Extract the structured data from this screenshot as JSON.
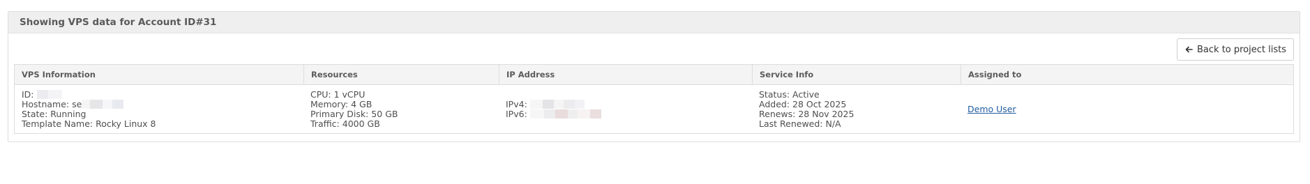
{
  "panel": {
    "title": "Showing VPS data for Account ID#31"
  },
  "toolbar": {
    "back_label": "Back to project lists",
    "back_icon": "arrow-left-icon"
  },
  "table": {
    "headers": [
      "VPS Information",
      "Resources",
      "IP Address",
      "Service Info",
      "Assigned to"
    ],
    "vps_info": {
      "id_label": "ID:",
      "hostname_label": "Hostname: se",
      "state": "State: Running",
      "template": "Template Name: Rocky Linux 8"
    },
    "resources": {
      "cpu": "CPU: 1 vCPU",
      "memory": "Memory: 4 GB",
      "disk": "Primary Disk: 50 GB",
      "traffic": "Traffic: 4000 GB"
    },
    "ip": {
      "ipv4_label": "IPv4:",
      "ipv6_label": "IPv6:"
    },
    "service": {
      "status": "Status: Active",
      "added": "Added: 28 Oct 2025",
      "renews": "Renews: 28 Nov 2025",
      "last_renewed": "Last Renewed: N/A"
    },
    "assigned": {
      "user": "Demo User"
    }
  },
  "colors": {
    "link": "#1f5c9e",
    "heading_bg": "#efefef",
    "border": "#dddddd"
  }
}
